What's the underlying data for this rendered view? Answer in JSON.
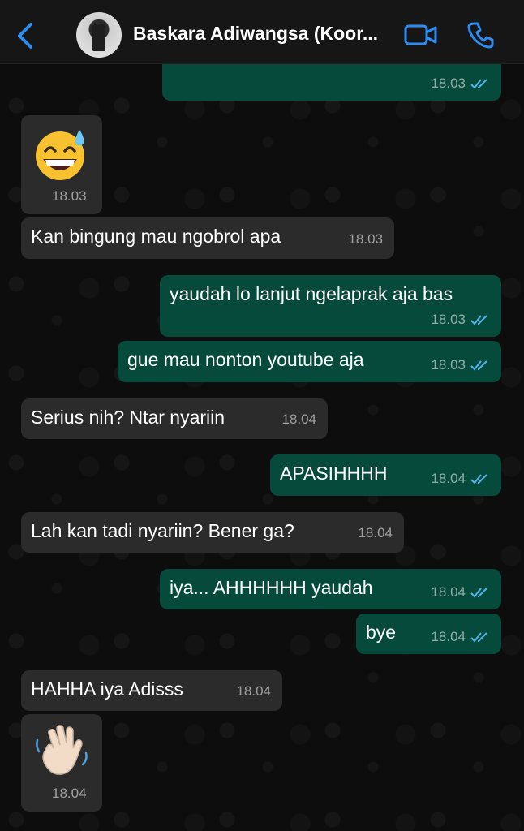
{
  "header": {
    "contact_name": "Baskara Adiwangsa (Koor...",
    "back_icon": "chevron-left-icon",
    "video_icon": "video-call-icon",
    "call_icon": "phone-icon",
    "accent": "#2e8cf0"
  },
  "colors": {
    "outgoing_bubble": "#054a3a",
    "incoming_bubble": "#2b2b2b",
    "read_ticks": "#4fb6ec"
  },
  "messages": [
    {
      "dir": "out",
      "text": "",
      "time": "18.03",
      "read": true
    },
    {
      "dir": "in",
      "type": "emoji",
      "emoji": "grinning-face-with-sweat",
      "time": "18.03"
    },
    {
      "dir": "in",
      "text": "Kan bingung mau ngobrol apa",
      "time": "18.03"
    },
    {
      "dir": "out",
      "text": "yaudah lo lanjut ngelaprak aja bas",
      "time": "18.03",
      "read": true
    },
    {
      "dir": "out",
      "text": "gue mau nonton youtube aja",
      "time": "18.03",
      "read": true
    },
    {
      "dir": "in",
      "text": "Serius nih? Ntar nyariin",
      "time": "18.04"
    },
    {
      "dir": "out",
      "text": "APASIHHHH",
      "time": "18.04",
      "read": true
    },
    {
      "dir": "in",
      "text": "Lah kan tadi nyariin? Bener ga?",
      "time": "18.04"
    },
    {
      "dir": "out",
      "text": "iya... AHHHHHH yaudah",
      "time": "18.04",
      "read": true
    },
    {
      "dir": "out",
      "text": "bye",
      "time": "18.04",
      "read": true
    },
    {
      "dir": "in",
      "text": "HAHHA iya Adisss",
      "time": "18.04"
    },
    {
      "dir": "in",
      "type": "emoji",
      "emoji": "waving-hand",
      "time": "18.04"
    }
  ]
}
